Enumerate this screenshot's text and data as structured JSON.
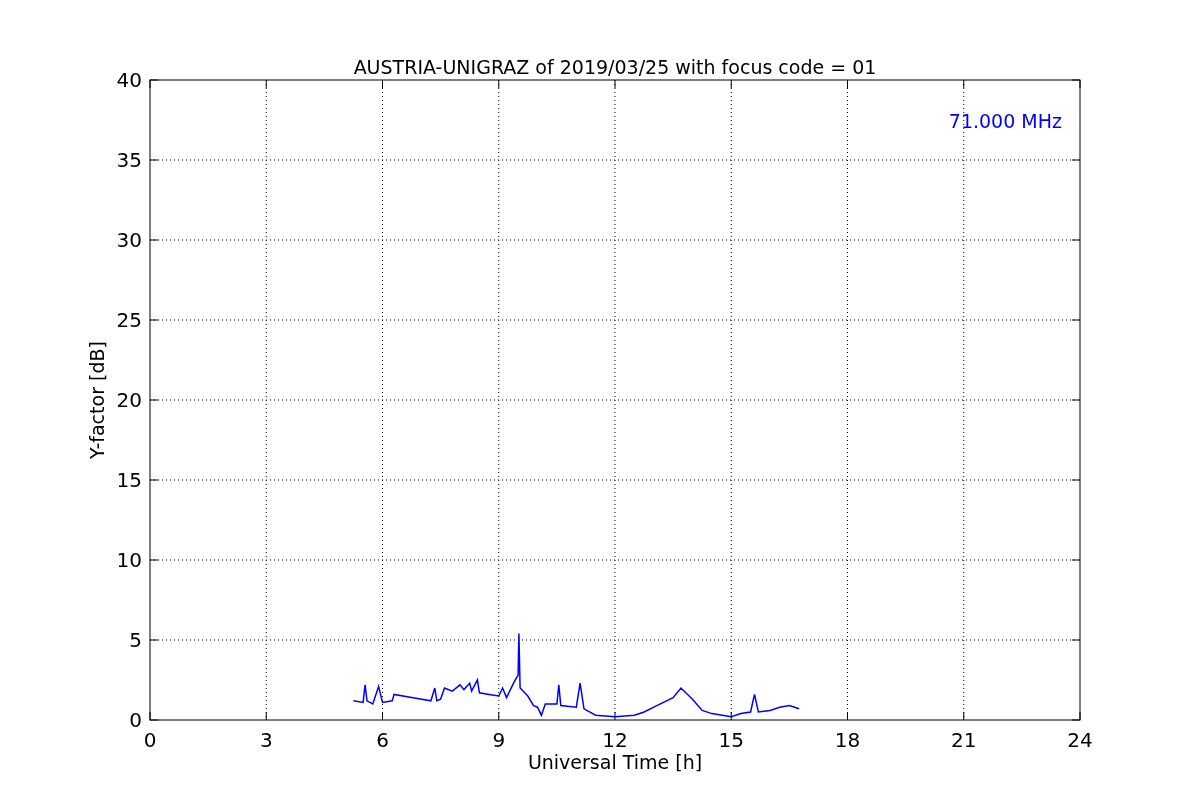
{
  "chart_data": {
    "type": "line",
    "title": "AUSTRIA-UNIGRAZ of 2019/03/25 with focus code = 01",
    "xlabel": "Universal Time [h]",
    "ylabel": "Y-factor [dB]",
    "grid": true,
    "xlim": [
      0,
      24
    ],
    "ylim": [
      0,
      40
    ],
    "xticks": [
      0,
      3,
      6,
      9,
      12,
      15,
      18,
      21,
      24
    ],
    "yticks": [
      0,
      5,
      10,
      15,
      20,
      25,
      30,
      35,
      40
    ],
    "x": [
      5.25,
      5.5,
      5.55,
      5.6,
      5.75,
      5.9,
      6.0,
      6.25,
      6.3,
      6.75,
      7.25,
      7.35,
      7.4,
      7.5,
      7.6,
      7.8,
      8.0,
      8.1,
      8.25,
      8.3,
      8.45,
      8.5,
      8.75,
      9.0,
      9.1,
      9.2,
      9.4,
      9.5,
      9.52,
      9.55,
      9.75,
      9.9,
      10.0,
      10.1,
      10.2,
      10.5,
      10.55,
      10.6,
      11.0,
      11.1,
      11.2,
      11.5,
      12.0,
      12.5,
      12.75,
      13.0,
      13.5,
      13.7,
      14.0,
      14.25,
      14.5,
      15.0,
      15.25,
      15.5,
      15.6,
      15.7,
      16.0,
      16.25,
      16.5,
      16.75
    ],
    "series": [
      {
        "name": "71.000 MHz",
        "color": "#0000ff",
        "values": [
          1.2,
          1.1,
          2.2,
          1.2,
          1.0,
          2.1,
          1.1,
          1.2,
          1.6,
          1.4,
          1.2,
          2.0,
          1.2,
          1.3,
          2.0,
          1.8,
          2.2,
          1.9,
          2.3,
          1.8,
          2.5,
          1.7,
          1.6,
          1.5,
          2.0,
          1.4,
          2.4,
          2.8,
          5.4,
          2.0,
          1.5,
          0.9,
          0.8,
          0.3,
          1.0,
          1.0,
          2.2,
          0.9,
          0.8,
          2.3,
          0.7,
          0.3,
          0.2,
          0.3,
          0.5,
          0.8,
          1.4,
          2.0,
          1.3,
          0.6,
          0.4,
          0.2,
          0.4,
          0.5,
          1.6,
          0.5,
          0.6,
          0.8,
          0.9,
          0.7
        ]
      }
    ]
  }
}
